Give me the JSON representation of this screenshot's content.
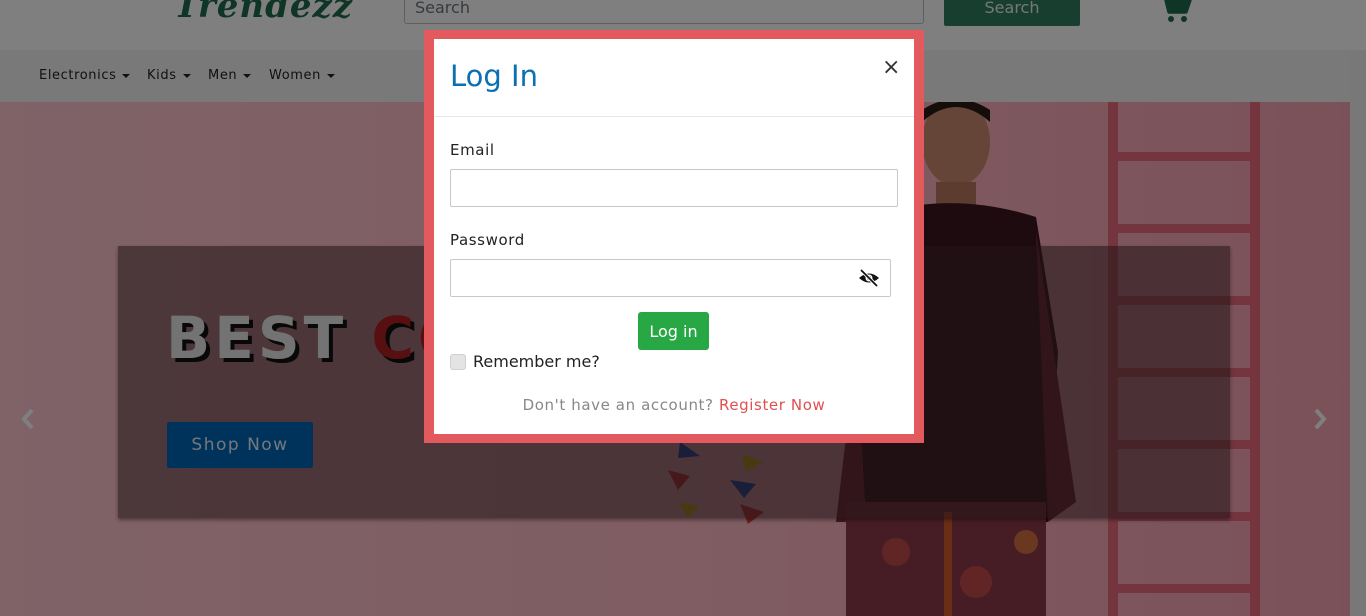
{
  "header": {
    "logo_text": "Trendezz",
    "search_placeholder": "Search",
    "search_button_label": "Search",
    "cart_icon": "cart-icon"
  },
  "nav": {
    "items": [
      {
        "label": "Electronics"
      },
      {
        "label": "Kids"
      },
      {
        "label": "Men"
      },
      {
        "label": "Women"
      }
    ]
  },
  "hero": {
    "headline_part1": "BEST ",
    "headline_part2": "CO",
    "shop_button_label": "Shop Now",
    "prev_icon": "chevron-left-icon",
    "next_icon": "chevron-right-icon"
  },
  "modal": {
    "title": "Log In",
    "close_label": "×",
    "email_label": "Email",
    "email_value": "",
    "password_label": "Password",
    "password_value": "",
    "password_toggle_icon": "eye-slash-icon",
    "login_button_label": "Log in",
    "remember_label": "Remember me?",
    "remember_checked": false,
    "no_account_text": "Don't have an account? ",
    "register_link_label": "Register Now"
  },
  "colors": {
    "brand_green": "#2e7d5e",
    "modal_border": "#e35a5e",
    "title_blue": "#0a6fb3",
    "login_green": "#28a745",
    "shop_blue": "#0067b8",
    "register_red": "#e05050"
  }
}
